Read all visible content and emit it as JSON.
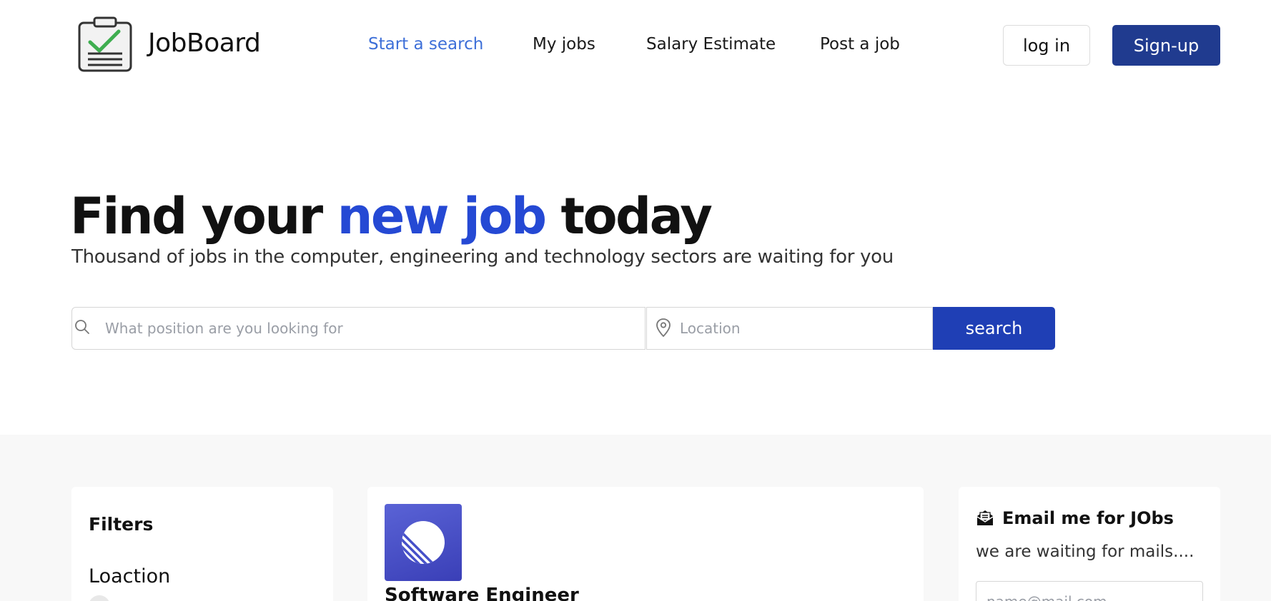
{
  "brand": {
    "name": "JobBoard",
    "logo_icon": "clipboard-check-icon",
    "check_color": "#3fae50"
  },
  "nav": {
    "links": [
      {
        "label": "Start a search",
        "active": true
      },
      {
        "label": "My jobs",
        "active": false
      },
      {
        "label": "Salary Estimate",
        "active": false
      },
      {
        "label": "Post a job",
        "active": false
      }
    ],
    "login_label": "log in",
    "signup_label": "Sign-up"
  },
  "hero": {
    "title_part1": "Find your ",
    "title_accent": "new job",
    "title_part2": " today",
    "subtitle": "Thousand of jobs in the computer, engineering and technology sectors are waiting for you",
    "search_placeholder": "What position are you looking for",
    "location_placeholder": "Location",
    "search_button": "search"
  },
  "filters": {
    "title": "Filters",
    "location_heading": "Loaction"
  },
  "job": {
    "title": "Software Engineer",
    "logo_icon": "company-logo-icon"
  },
  "email_alert": {
    "icon": "envelope-open-icon",
    "title": "Email me for JObs",
    "subtitle": "we are waiting for mails....",
    "placeholder": "name@mail.com"
  },
  "colors": {
    "accent": "#2549d4",
    "nav_active": "#3d6fd8",
    "primary_button": "#1f3fb5",
    "signup_button": "#203b8f"
  }
}
